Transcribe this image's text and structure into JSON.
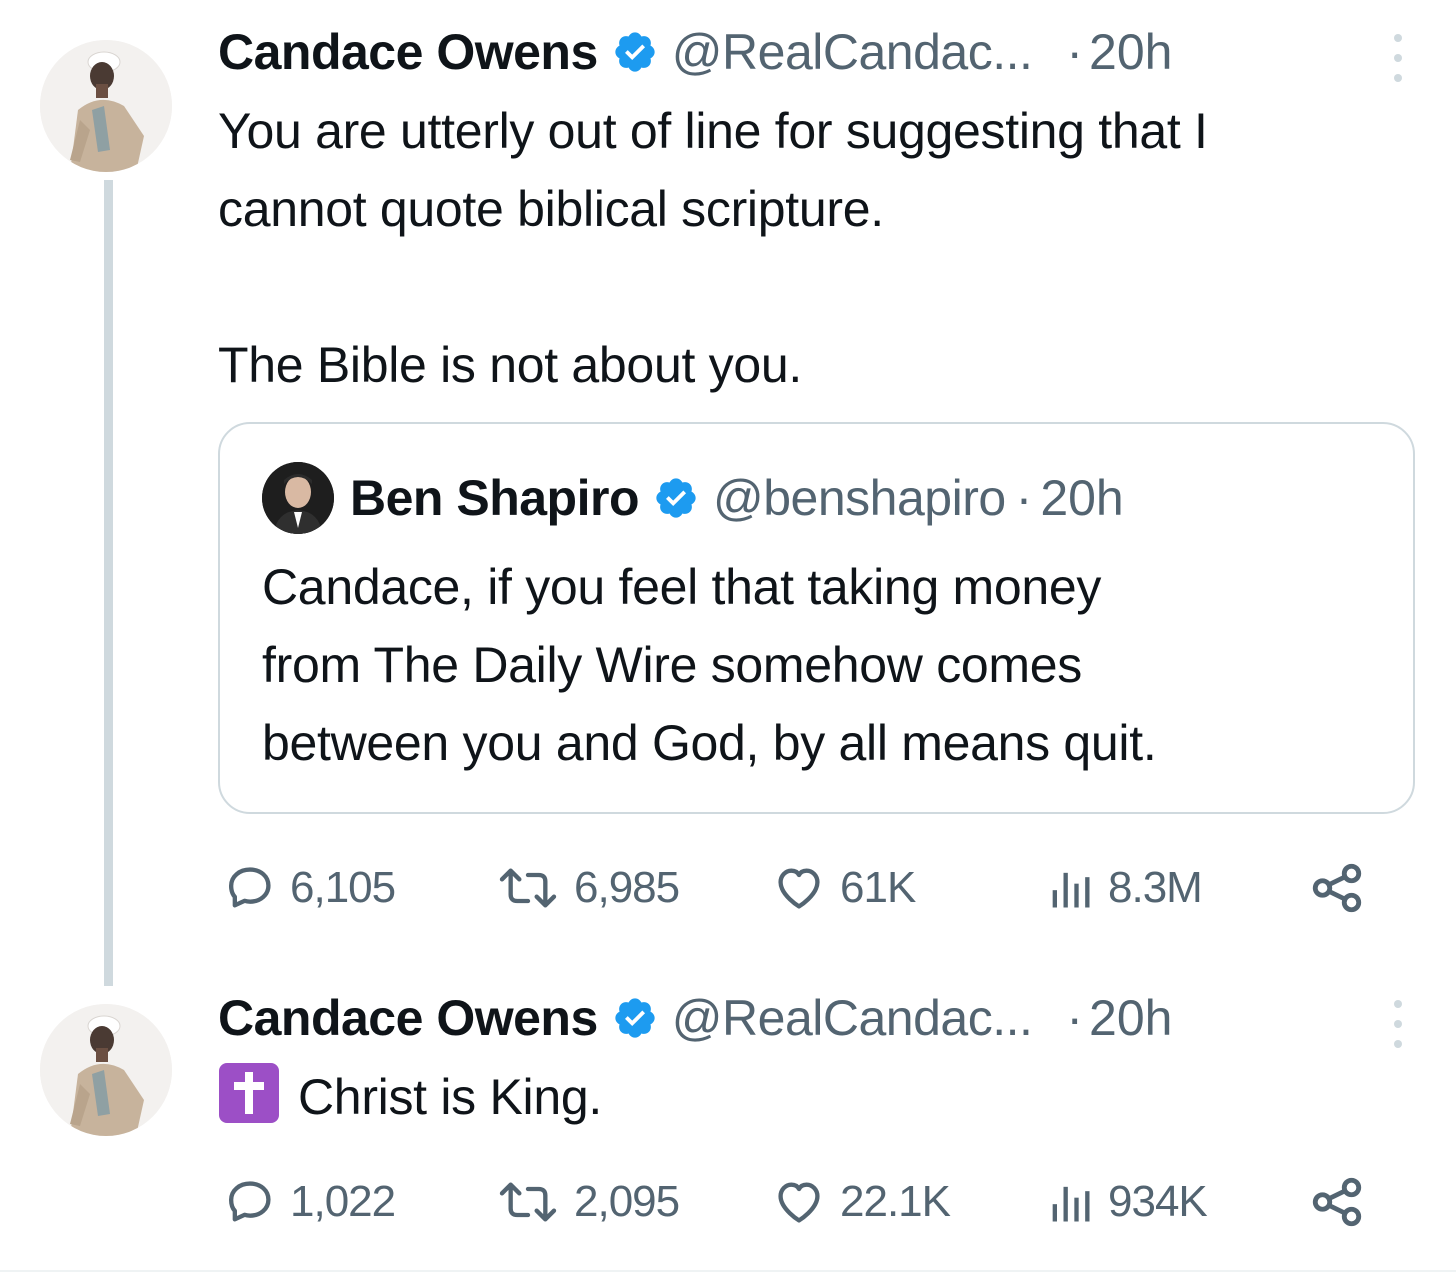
{
  "tweets": [
    {
      "author": {
        "name": "Candace Owens",
        "handle": "@RealCandac...",
        "verified": true
      },
      "separator": "·",
      "time": "20h",
      "text_lines": [
        "You are utterly out of line for suggesting that I",
        "cannot quote biblical scripture.",
        "",
        "The Bible is not about you."
      ],
      "quote": {
        "author": {
          "name": "Ben Shapiro",
          "handle": "@benshapiro",
          "verified": true
        },
        "separator": "·",
        "time": "20h",
        "text_lines": [
          "Candace, if you feel that taking money",
          "from The Daily Wire somehow comes",
          "between you and God, by all means quit."
        ]
      },
      "stats": {
        "replies": "6,105",
        "reposts": "6,985",
        "likes": "61K",
        "views": "8.3M"
      }
    },
    {
      "author": {
        "name": "Candace Owens",
        "handle": "@RealCandac...",
        "verified": true
      },
      "separator": "·",
      "time": "20h",
      "emoji": "latin-cross-emoji",
      "text": "Christ is King.",
      "stats": {
        "replies": "1,022",
        "reposts": "2,095",
        "likes": "22.1K",
        "views": "934K"
      }
    }
  ],
  "colors": {
    "text": "#0f1419",
    "secondary": "#536471",
    "verified": "#1d9bf0",
    "border": "#cfd9de",
    "emoji_bg": "#9c4fc6"
  },
  "icons": {
    "reply": "reply-icon",
    "repost": "repost-icon",
    "like": "heart-icon",
    "views": "views-icon",
    "share": "share-icon",
    "more": "more-icon",
    "verified": "verified-badge-icon"
  }
}
